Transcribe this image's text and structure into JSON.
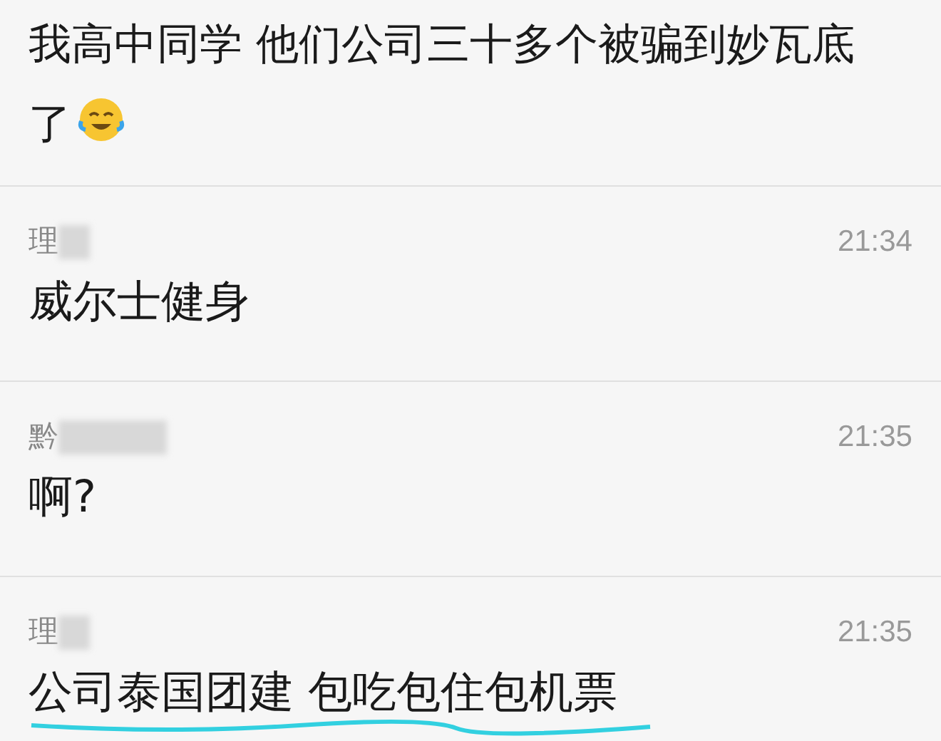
{
  "top_message": {
    "text": "我高中同学 他们公司三十多个被骗到妙瓦底了",
    "emoji": true
  },
  "messages": [
    {
      "sender": "理",
      "time": "21:34",
      "text": "威尔士健身",
      "underlined": false
    },
    {
      "sender": "黔",
      "time": "21:35",
      "text": "啊?",
      "underlined": false
    },
    {
      "sender": "理",
      "time": "21:35",
      "text": "公司泰国团建 包吃包住包机票",
      "underlined": true
    }
  ]
}
